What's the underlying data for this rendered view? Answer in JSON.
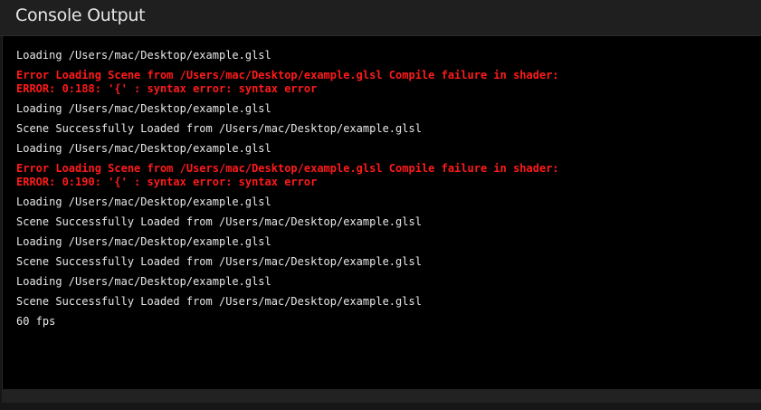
{
  "header": {
    "title": "Console Output"
  },
  "colors": {
    "error": "#ff1a1a",
    "normal": "#e8e8e8",
    "background": "#000000"
  },
  "console": {
    "lines": [
      {
        "text": "Loading /Users/mac/Desktop/example.glsl",
        "type": "info"
      },
      {
        "text": "Error Loading Scene from /Users/mac/Desktop/example.glsl Compile failure in shader:\nERROR: 0:188: '{' : syntax error: syntax error",
        "type": "error"
      },
      {
        "text": "Loading /Users/mac/Desktop/example.glsl",
        "type": "info"
      },
      {
        "text": "Scene Successfully Loaded from /Users/mac/Desktop/example.glsl",
        "type": "info"
      },
      {
        "text": "Loading /Users/mac/Desktop/example.glsl",
        "type": "info"
      },
      {
        "text": "Error Loading Scene from /Users/mac/Desktop/example.glsl Compile failure in shader:\nERROR: 0:190: '{' : syntax error: syntax error",
        "type": "error"
      },
      {
        "text": "Loading /Users/mac/Desktop/example.glsl",
        "type": "info"
      },
      {
        "text": "Scene Successfully Loaded from /Users/mac/Desktop/example.glsl",
        "type": "info"
      },
      {
        "text": "Loading /Users/mac/Desktop/example.glsl",
        "type": "info"
      },
      {
        "text": "Scene Successfully Loaded from /Users/mac/Desktop/example.glsl",
        "type": "info"
      },
      {
        "text": "Loading /Users/mac/Desktop/example.glsl",
        "type": "info"
      },
      {
        "text": "Scene Successfully Loaded from /Users/mac/Desktop/example.glsl",
        "type": "info"
      },
      {
        "text": "60 fps",
        "type": "info"
      }
    ]
  }
}
